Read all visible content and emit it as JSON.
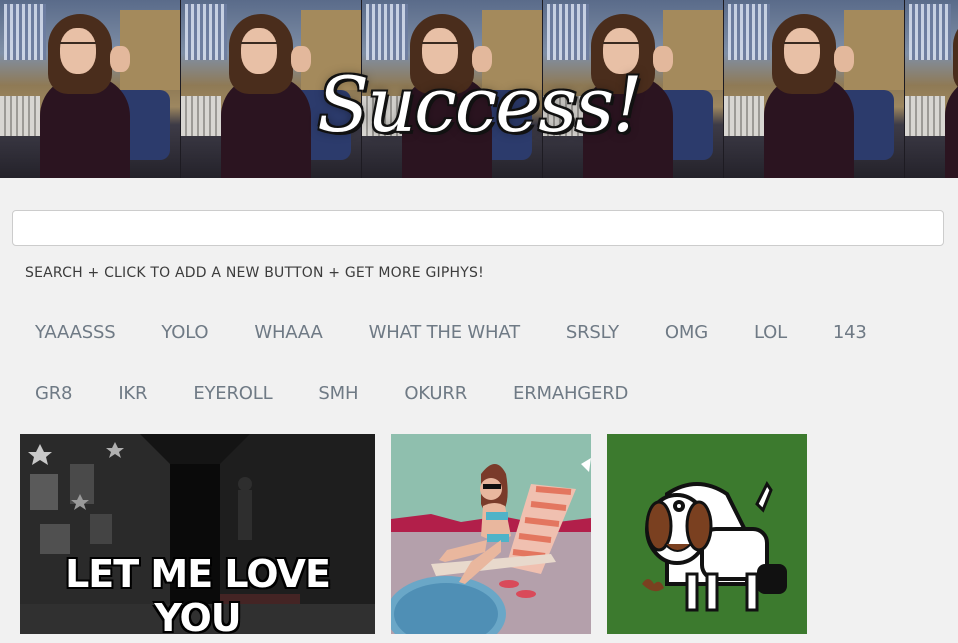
{
  "header": {
    "title": "Success!",
    "tile_count": 6
  },
  "search": {
    "value": "",
    "placeholder": ""
  },
  "hint": "SEARCH + CLICK TO ADD A NEW BUTTON + GET MORE GIPHYS!",
  "topics": {
    "row1": [
      "YAAASSS",
      "YOLO",
      "WHAAA",
      "WHAT THE WHAT",
      "SRSLY",
      "OMG",
      "LOL",
      "143"
    ],
    "row2": [
      "GR8",
      "IKR",
      "EYEROLL",
      "SMH",
      "OKURR",
      "ERMAHGERD"
    ]
  },
  "gifs": [
    {
      "name": "haunted-hallway-gif",
      "caption": "LET ME LOVE YOU"
    },
    {
      "name": "poolside-woman-gif",
      "caption": ""
    },
    {
      "name": "cartoon-dog-gif",
      "caption": ""
    }
  ],
  "colors": {
    "background": "#f1f1f1",
    "topic_text": "#6f7a85",
    "dog_background": "#3c7a2e",
    "pool_background": "#8fbfae"
  }
}
